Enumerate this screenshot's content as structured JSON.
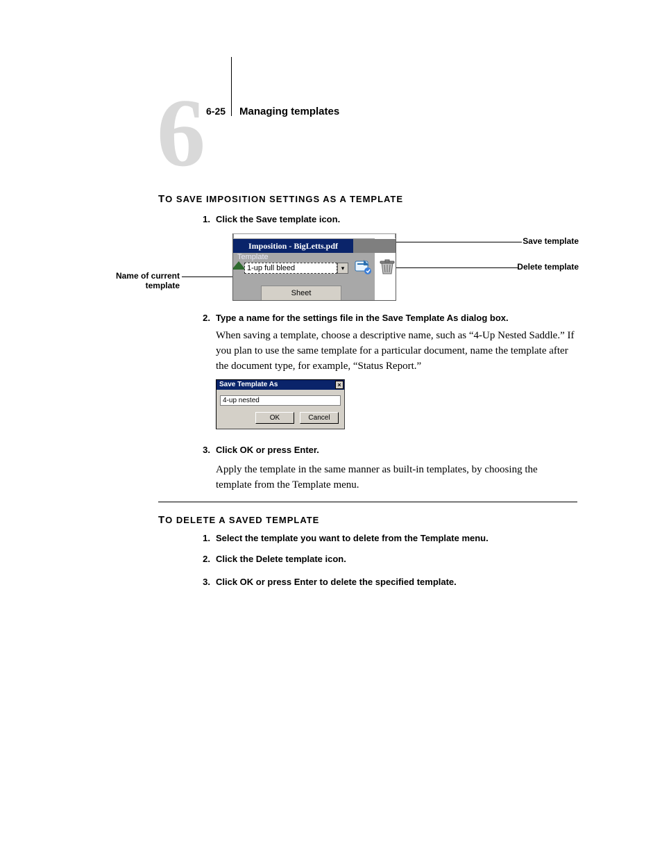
{
  "header": {
    "chapter_number_bg": "6",
    "page_ref": "6-25",
    "title": "Managing templates"
  },
  "section1": {
    "heading_prefix": "T",
    "heading_rest": "O SAVE IMPOSITION SETTINGS AS A TEMPLATE",
    "steps": {
      "s1_num": "1.",
      "s1_text": "Click the Save template icon.",
      "s2_num": "2.",
      "s2_text": "Type a name for the settings file in the Save Template As dialog box.",
      "s3_num": "3.",
      "s3_text": "Click OK or press Enter."
    },
    "para_after_s2": "When saving a template, choose a descriptive name, such as “4-Up Nested Saddle.” If you plan to use the same template for a particular document, name the template after the document type, for example, “Status Report.”",
    "para_after_s3": "Apply the template in the same manner as built-in templates, by choosing the template from the Template menu."
  },
  "callouts": {
    "left": "Name of current template",
    "right_top": "Save template",
    "right_bottom": "Delete template"
  },
  "shot1": {
    "title": "Imposition - BigLetts.pdf",
    "section_label": "Template",
    "dropdown_value": "1-up full bleed",
    "dropdown_arrow": "▾",
    "bottom_tab": "Sheet"
  },
  "shot2": {
    "title": "Save Template As",
    "close": "×",
    "input_value": "4-up nested",
    "ok": "OK",
    "cancel": "Cancel"
  },
  "section2": {
    "heading_prefix": "T",
    "heading_rest": "O DELETE A SAVED TEMPLATE",
    "s1_num": "1.",
    "s1_text": "Select the template you want to delete from the Template menu.",
    "s2_num": "2.",
    "s2_text": "Click the Delete template icon.",
    "s3_num": "3.",
    "s3_text": "Click OK or press Enter to delete the specified template."
  }
}
